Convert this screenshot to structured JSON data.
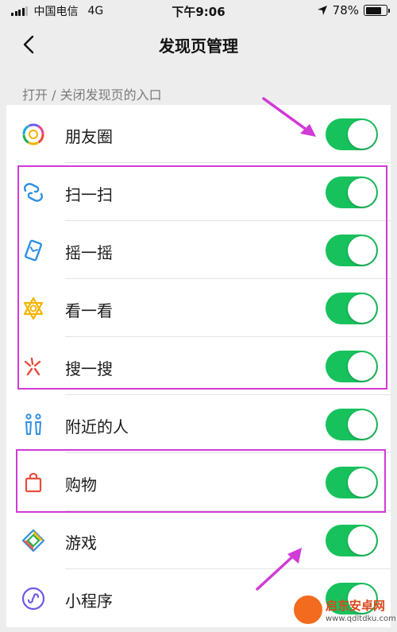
{
  "status_bar": {
    "carrier": "中国电信",
    "network": "4G",
    "time": "下午9:06",
    "battery_text": "78%",
    "battery_level": 0.78
  },
  "nav": {
    "title": "发现页管理",
    "back_icon": "chevron-left-icon"
  },
  "section_header": "打开 / 关闭发现页的入口",
  "items": [
    {
      "label": "朋友圈",
      "icon": "moments-icon",
      "enabled": true
    },
    {
      "label": "扫一扫",
      "icon": "scan-icon",
      "enabled": true
    },
    {
      "label": "摇一摇",
      "icon": "shake-icon",
      "enabled": true
    },
    {
      "label": "看一看",
      "icon": "top-stories-icon",
      "enabled": true
    },
    {
      "label": "搜一搜",
      "icon": "search-icon",
      "enabled": true
    },
    {
      "label": "附近的人",
      "icon": "people-nearby-icon",
      "enabled": true
    },
    {
      "label": "购物",
      "icon": "shopping-bag-icon",
      "enabled": true
    },
    {
      "label": "游戏",
      "icon": "game-icon",
      "enabled": true
    },
    {
      "label": "小程序",
      "icon": "mini-program-icon",
      "enabled": true
    }
  ],
  "colors": {
    "toggle_on": "#17c25c",
    "highlight": "#d13bd6",
    "background": "#ededed"
  },
  "watermark": {
    "title": "启东安卓网",
    "url": "www.qdltdku.com"
  }
}
